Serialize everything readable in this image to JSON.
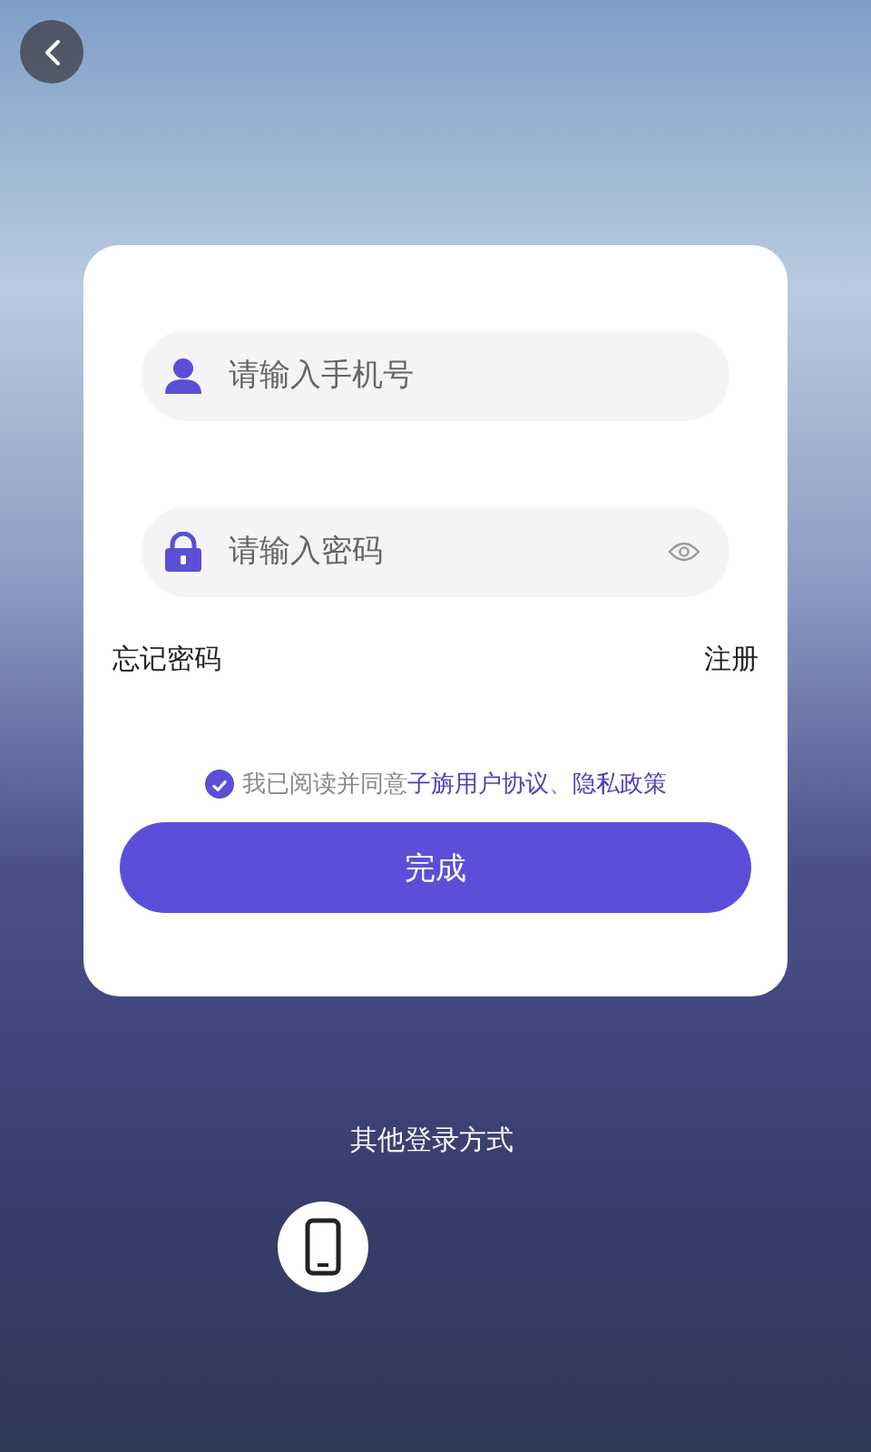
{
  "phone_field": {
    "placeholder": "请输入手机号"
  },
  "password_field": {
    "placeholder": "请输入密码"
  },
  "links": {
    "forgot": "忘记密码",
    "register": "注册"
  },
  "agreement": {
    "checked": true,
    "parts": [
      {
        "kind": "text",
        "text": "我已阅读并同意"
      },
      {
        "kind": "link",
        "text": "子旃用户协议"
      },
      {
        "kind": "text",
        "text": "、"
      },
      {
        "kind": "link",
        "text": "隐私政策"
      }
    ]
  },
  "submit_button": "完成",
  "other_login": {
    "title": "其他登录方式"
  }
}
